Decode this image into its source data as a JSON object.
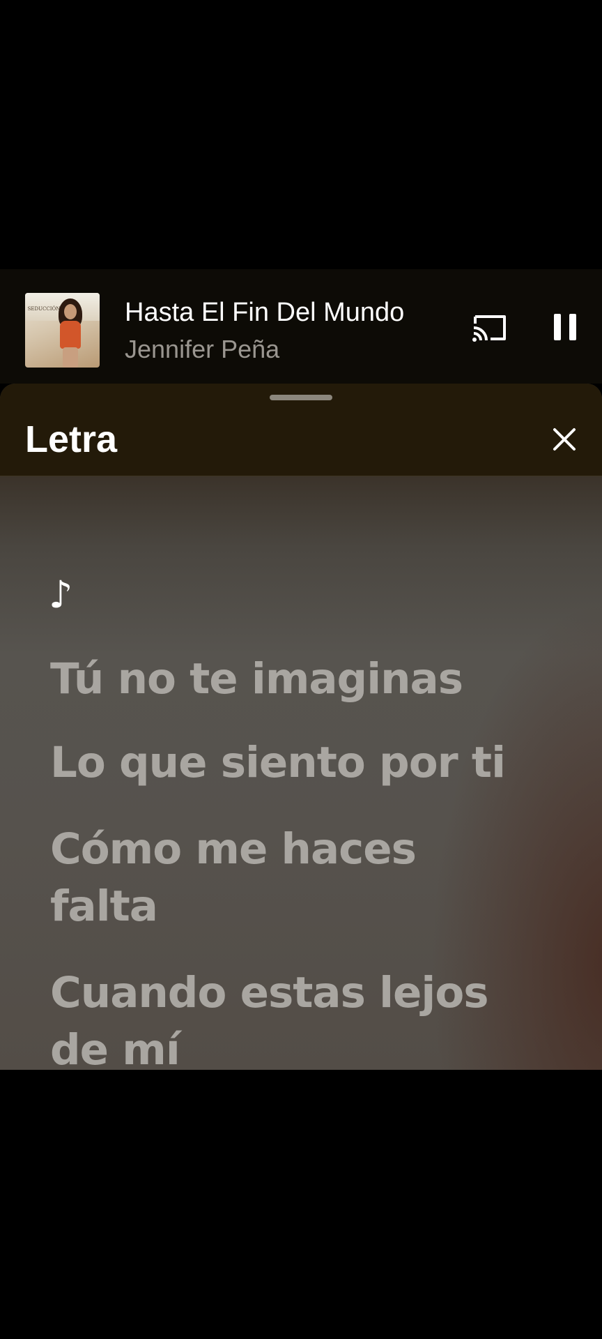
{
  "mini_player": {
    "title": "Hasta El Fin Del Mundo",
    "artist": "Jennifer Peña",
    "album_art_text": "SEDUCCIÓN",
    "cast_icon": "cast-icon",
    "pause_icon": "pause-icon"
  },
  "lyrics_sheet": {
    "title": "Letra",
    "close_icon": "close-icon",
    "note_symbol": "♪",
    "lines": [
      "Tú no te imaginas",
      "Lo que siento por ti",
      "Cómo me haces falta",
      "Cuando estas lejos de mí"
    ]
  },
  "colors": {
    "background": "#000000",
    "header": "#231a09",
    "lyric_inactive": "#a9a6a1",
    "text_primary": "#ffffff",
    "text_secondary": "#9a9690"
  }
}
